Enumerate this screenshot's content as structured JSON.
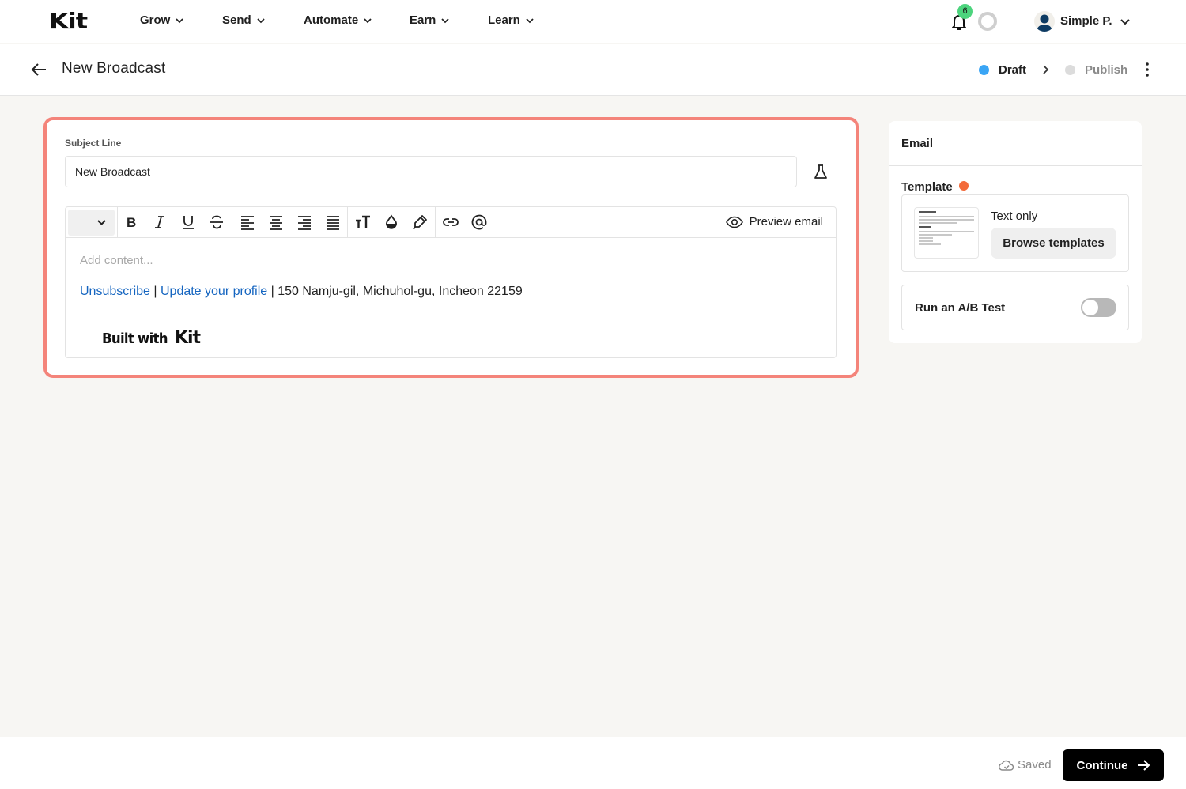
{
  "nav": {
    "logo": "Kit",
    "items": [
      {
        "label": "Grow"
      },
      {
        "label": "Send"
      },
      {
        "label": "Automate"
      },
      {
        "label": "Earn"
      },
      {
        "label": "Learn"
      }
    ],
    "notification_count": "6",
    "user_name": "Simple P."
  },
  "header": {
    "title": "New Broadcast",
    "steps": [
      {
        "label": "Draft",
        "state": "active",
        "color": "#3aa5f5"
      },
      {
        "label": "Publish",
        "state": "inactive",
        "color": "#dcdcdc"
      }
    ]
  },
  "editor": {
    "subject_label": "Subject Line",
    "subject_value": "New Broadcast",
    "toolbar": {
      "buttons": [
        "bold",
        "italic",
        "underline",
        "strikethrough",
        "align-left",
        "align-center",
        "align-right",
        "align-justify",
        "font-size",
        "text-color",
        "highlight",
        "link",
        "mention"
      ],
      "preview_label": "Preview email"
    },
    "content_placeholder": "Add content...",
    "footer": {
      "unsubscribe": "Unsubscribe",
      "separator": " | ",
      "update_profile": "Update your profile",
      "address": " | 150 Namju-gil, Michuhol-gu, Incheon 22159"
    },
    "built_with": "Built with",
    "built_with_logo": "Kit"
  },
  "side_panel": {
    "title": "Email",
    "template_label": "Template",
    "template_name": "Text only",
    "browse_label": "Browse templates",
    "ab_test_label": "Run an A/B Test",
    "ab_test_enabled": false
  },
  "bottom": {
    "saved_label": "Saved",
    "continue_label": "Continue"
  },
  "colors": {
    "highlight_border": "#f4847a",
    "link": "#1565c0",
    "draft_dot": "#3aa5f5",
    "template_dot": "#f36b3b",
    "badge": "#4cd47d"
  }
}
